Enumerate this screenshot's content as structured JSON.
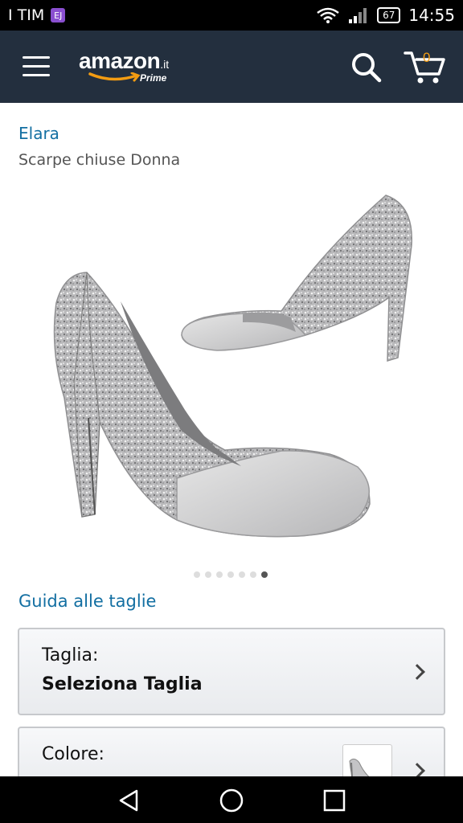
{
  "status_bar": {
    "carrier": "I TIM",
    "carrier_badge": "EJ",
    "battery": "67",
    "time": "14:55"
  },
  "header": {
    "logo_text": "amazon",
    "logo_tld": ".it",
    "logo_sub": "Prime",
    "cart_count": "0",
    "accent_color": "#f39c12",
    "bg_color": "#232f3e"
  },
  "product": {
    "brand": "Elara",
    "subtitle": "Scarpe chiuse Donna",
    "image_icon": "silver-glitter-pump-image",
    "carousel": {
      "total": 7,
      "active_index": 6
    }
  },
  "size_guide_link": "Guida alle taglie",
  "size_selector": {
    "label": "Taglia:",
    "value": "Seleziona Taglia"
  },
  "color_selector": {
    "label": "Colore:"
  },
  "link_color": "#136fa2"
}
